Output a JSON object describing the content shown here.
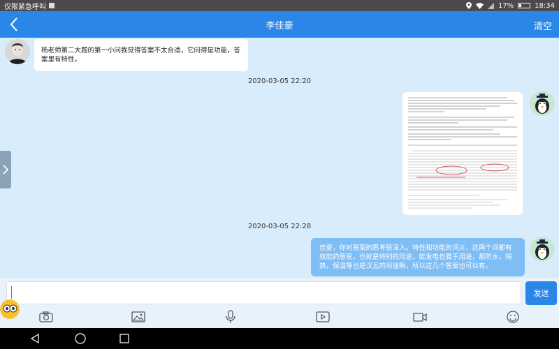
{
  "status_bar": {
    "carrier_text": "仅限紧急呼叫",
    "battery": "17%",
    "time": "18:34"
  },
  "header": {
    "title": "李佳豪",
    "clear_label": "清空"
  },
  "messages": [
    {
      "direction": "incoming",
      "text": "杨老师第二大题的第一小问我觉得答案不太合适，它问得是功能，答案里有特性。"
    },
    {
      "type": "timestamp",
      "text": "2020-03-05 22:20"
    },
    {
      "direction": "outgoing",
      "type": "image"
    },
    {
      "type": "timestamp",
      "text": "2020-03-05 22:28"
    },
    {
      "direction": "outgoing",
      "text": "佳豪，你对答案的思考很深入。特性和功能的词义，这两个词都有效能的意思，也就是特别的用途，能发电也属于用途，那防水，隔热，保温等也是汉瓦的用途啊，所以这几个答案也可以有。"
    }
  ],
  "input": {
    "value": "",
    "send_label": "发送"
  },
  "toolbar": [
    "camera-icon",
    "image-icon",
    "microphone-icon",
    "video-play-icon",
    "video-camera-icon",
    "emoji-icon"
  ],
  "nav_bar": [
    "back-nav-icon",
    "home-nav-icon",
    "recents-nav-icon"
  ],
  "colors": {
    "header_blue": "#2b87e7",
    "chat_background": "#d9ecfb",
    "outgoing_bubble": "#7fbdf5"
  }
}
